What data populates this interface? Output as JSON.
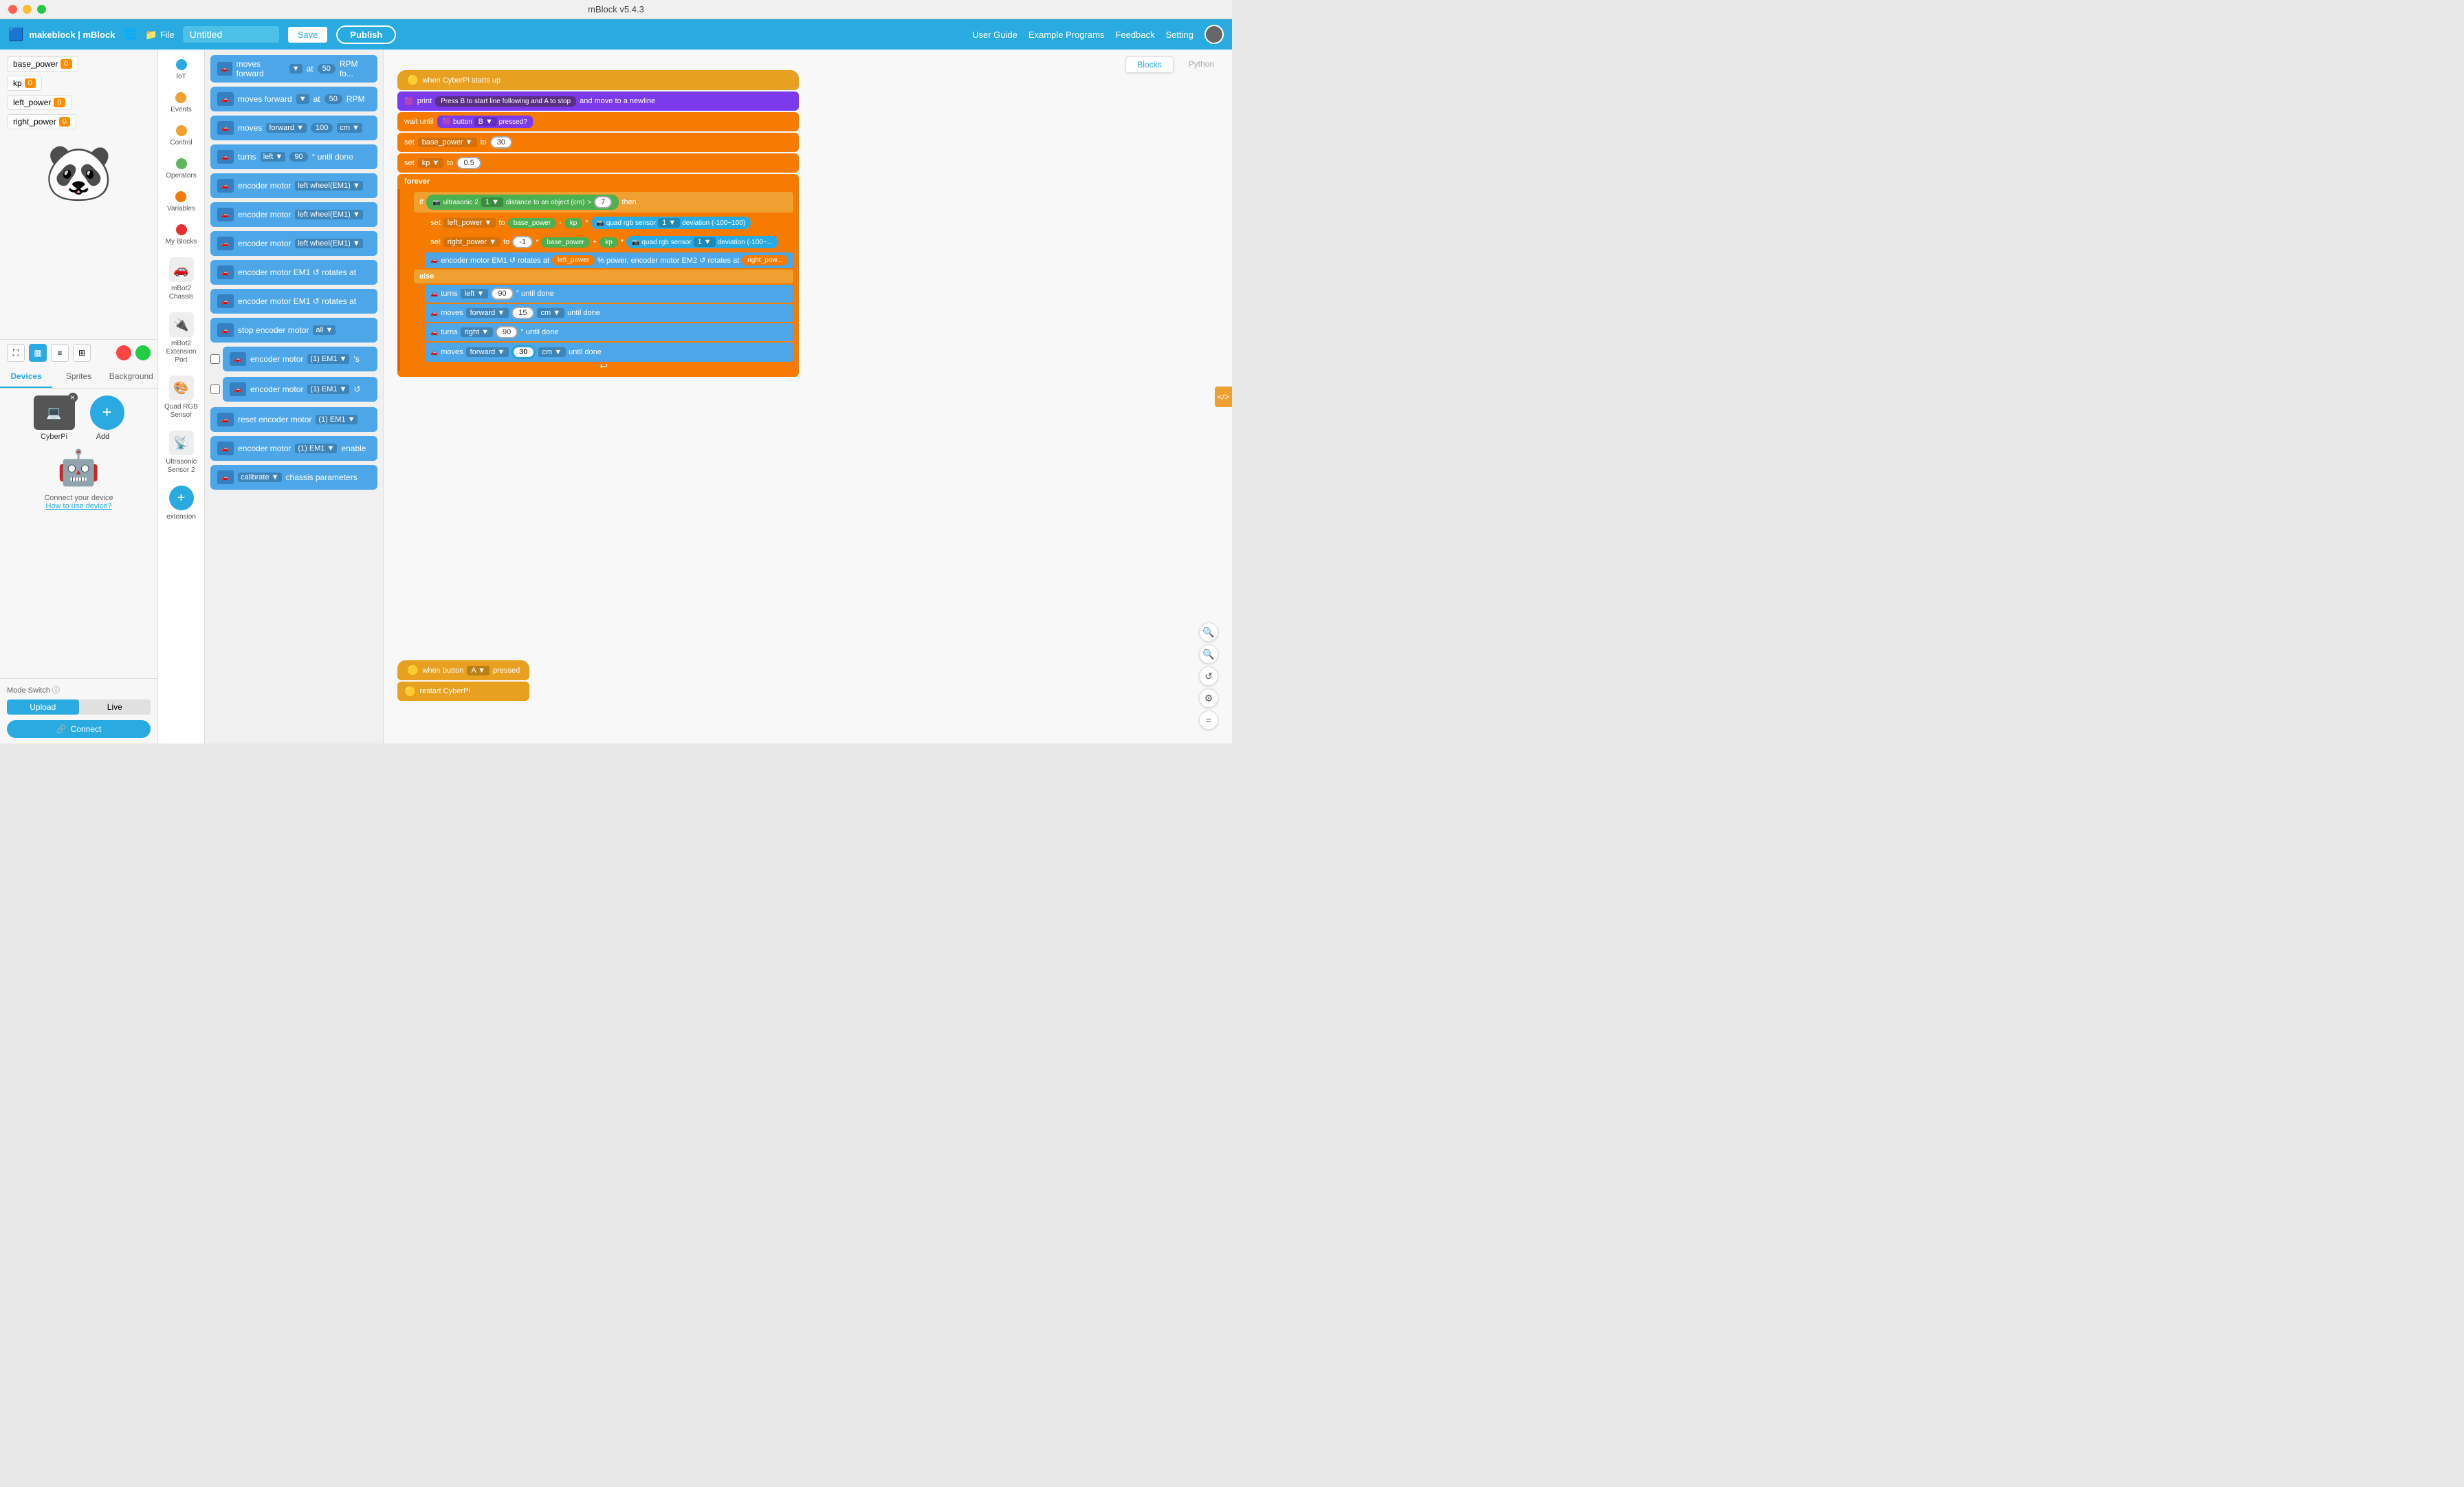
{
  "app": {
    "title": "mBlock v5.4.3",
    "window_title": "mBlock v5.4.3"
  },
  "menu": {
    "logo": "makeblock | mBlock",
    "file": "File",
    "title_value": "Untitled",
    "save": "Save",
    "publish": "Publish",
    "user_guide": "User Guide",
    "example_programs": "Example Programs",
    "feedback": "Feedback",
    "setting": "Setting"
  },
  "variables": [
    {
      "name": "base_power",
      "value": "0"
    },
    {
      "name": "kp",
      "value": "0"
    },
    {
      "name": "left_power",
      "value": "0"
    },
    {
      "name": "right_power",
      "value": "0"
    }
  ],
  "left_tabs": {
    "devices": "Devices",
    "sprites": "Sprites",
    "background": "Background"
  },
  "categories": [
    {
      "name": "IoT",
      "color": "#29abe2"
    },
    {
      "name": "Events",
      "color": "#f0a030"
    },
    {
      "name": "Control",
      "color": "#f0a030"
    },
    {
      "name": "Operators",
      "color": "#5cb85c"
    },
    {
      "name": "Variables",
      "color": "#f57c00"
    },
    {
      "name": "My Blocks",
      "color": "#e83030"
    },
    {
      "name": "mBot2 Chassis",
      "color": "#29abe2"
    },
    {
      "name": "mBot2 Extension Port",
      "color": "#29abe2"
    },
    {
      "name": "Quad RGB Sensor",
      "color": "#29abe2"
    },
    {
      "name": "Ultrasonic Sensor 2",
      "color": "#29abe2"
    },
    {
      "name": "+ extension",
      "color": "#29abe2"
    }
  ],
  "canvas_tabs": {
    "blocks": "Blocks",
    "python": "Python"
  },
  "mode_switch": {
    "label": "Mode Switch ⓘ",
    "upload": "Upload",
    "live": "Live",
    "connect": "Connect"
  },
  "device": {
    "name": "CyberPi",
    "add": "Add"
  },
  "connect_text": "Connect your device",
  "how_to": "How to use device?",
  "script1": {
    "hat": "when CyberPi starts up",
    "print_text": "Press B to start line following and A to stop",
    "wait_button": "B",
    "base_power_val": "30",
    "kp_val": "0.5",
    "ultrasonic_val": "7",
    "left_power": "left_power",
    "right_power": "right_power",
    "turn_left_deg": "90",
    "turn_right_deg": "90",
    "move_fwd1": "15",
    "move_fwd2": "30"
  },
  "script2": {
    "hat": "when button A ▼ pressed",
    "action": "restart CyberPi"
  },
  "blocks_panel": [
    "moves forward ▼ at 50 RPM fo...",
    "moves forward ▼ at 50 RPM",
    "moves forward ▼ 100 cm ▼",
    "turns left ▼ 90 ° until done",
    "encoder motor left wheel(EM1) ▼",
    "encoder motor left wheel(EM1) ▼",
    "encoder motor left wheel(EM1) ▼",
    "encoder motor EM1 ↺ rotates at",
    "encoder motor EM1 ↺ rotates at",
    "stop encoder motor all ▼",
    "encoder motor (1) EM1 ▼ 's",
    "encoder motor (1) EM1 ▼",
    "reset encoder motor (1) EM1 ▼",
    "encoder motor (1) EM1 ▼ enable",
    "calibrate ▼ chassis parameters"
  ]
}
